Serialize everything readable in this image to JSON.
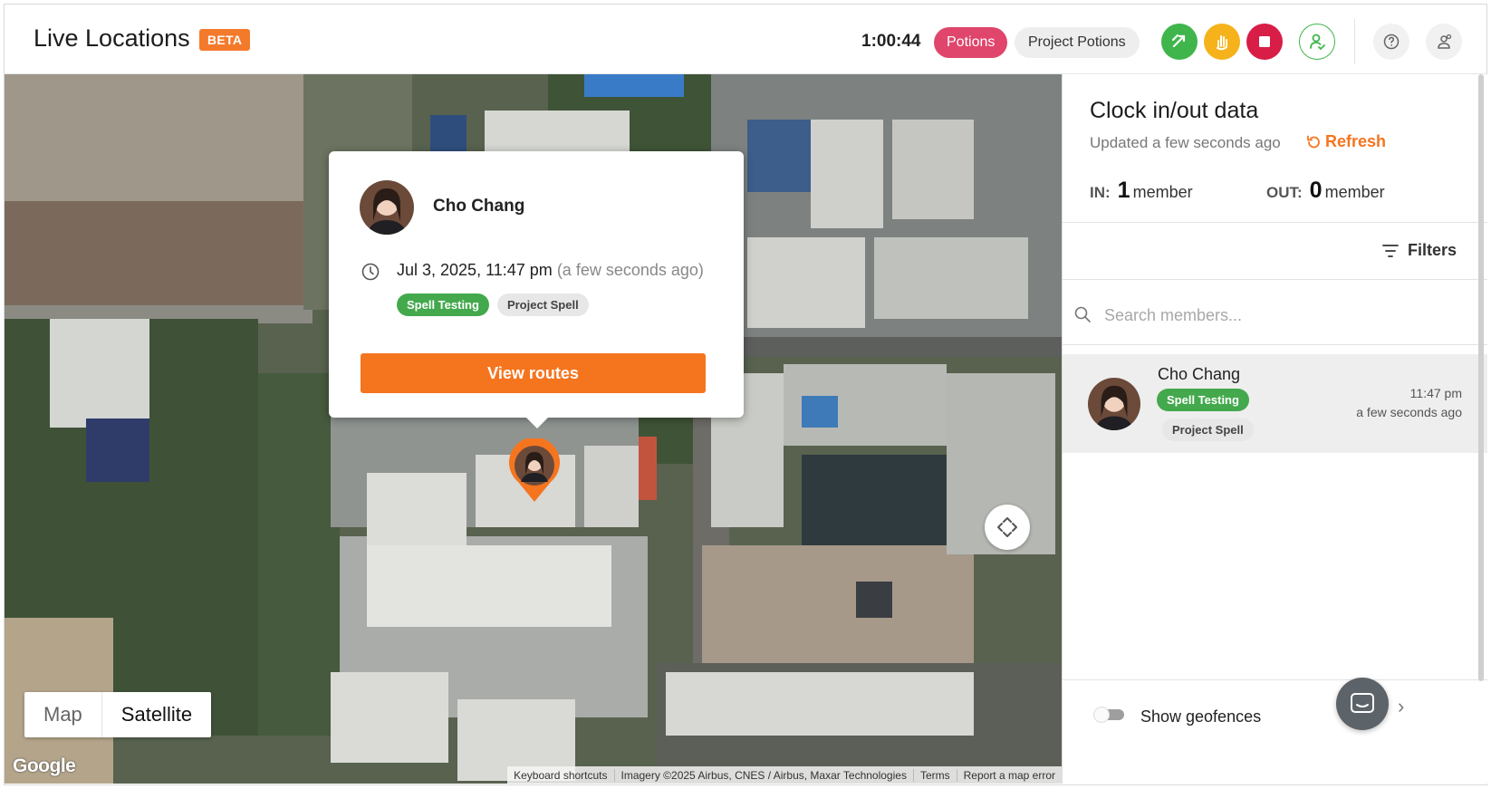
{
  "header": {
    "title": "Live Locations",
    "beta_badge": "BETA",
    "timer": "1:00:44",
    "chip_active": "Potions",
    "chip_project": "Project Potions",
    "colors": {
      "accent": "#f5751f",
      "active_chip": "#e0456c",
      "green": "#3fb54b",
      "yellow": "#f5b21b",
      "red": "#d81d46"
    },
    "icons": [
      "switch-job-icon",
      "break-hand-icon",
      "stop-icon",
      "user-check-icon",
      "help-icon",
      "settings-icon"
    ]
  },
  "map": {
    "popup": {
      "name": "Cho Chang",
      "datetime": "Jul 3, 2025, 11:47 pm",
      "ago": "(a few seconds ago)",
      "tag_activity": "Spell Testing",
      "tag_project": "Project Spell",
      "button": "View routes"
    },
    "type_map": "Map",
    "type_satellite": "Satellite",
    "google_logo": "Google",
    "attribution": {
      "shortcuts": "Keyboard shortcuts",
      "imagery": "Imagery ©2025 Airbus, CNES / Airbus, Maxar Technologies",
      "terms": "Terms",
      "report": "Report a map error"
    }
  },
  "sidebar": {
    "title": "Clock in/out data",
    "updated": "Updated a few seconds ago",
    "refresh": "Refresh",
    "in_label": "IN:",
    "in_count": "1",
    "in_unit": "member",
    "out_label": "OUT:",
    "out_count": "0",
    "out_unit": "member",
    "filters": "Filters",
    "search_placeholder": "Search members...",
    "members": [
      {
        "name": "Cho Chang",
        "tag_activity": "Spell Testing",
        "tag_project": "Project Spell",
        "time": "11:47 pm",
        "ago": "a few seconds ago"
      }
    ],
    "geofences_label": "Show geofences"
  }
}
